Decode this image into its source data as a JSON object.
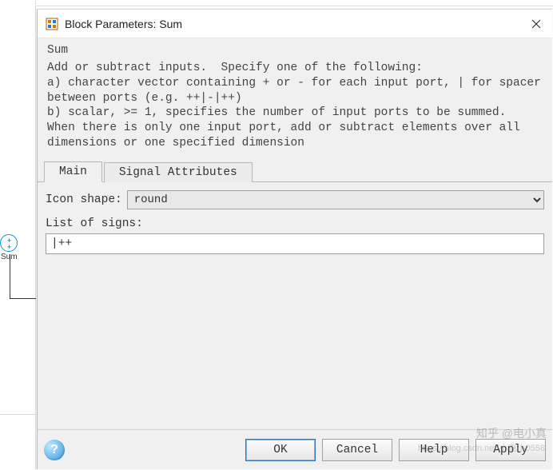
{
  "window": {
    "title": "Block Parameters: Sum"
  },
  "block": {
    "name": "Sum",
    "canvas_label": "Sum"
  },
  "description": "Add or subtract inputs.  Specify one of the following:\na) character vector containing + or - for each input port, | for spacer between ports (e.g. ++|-|++)\nb) scalar, >= 1, specifies the number of input ports to be summed.\nWhen there is only one input port, add or subtract elements over all dimensions or one specified dimension",
  "tabs": {
    "main": "Main",
    "signal_attributes": "Signal Attributes"
  },
  "main": {
    "icon_shape_label": "Icon shape:",
    "icon_shape_value": "round",
    "list_of_signs_label": "List of signs:",
    "list_of_signs_value": "|++"
  },
  "buttons": {
    "ok": "OK",
    "cancel": "Cancel",
    "help": "Help",
    "apply": "Apply"
  },
  "watermark": {
    "line1": "知乎 @电小真",
    "line2": "https://blog.csdn.net/小电小0558"
  }
}
